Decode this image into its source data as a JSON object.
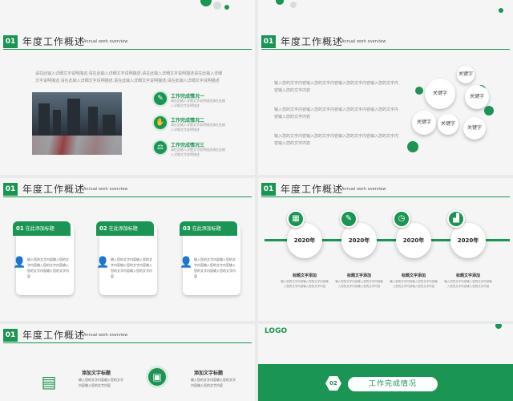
{
  "header": {
    "num": "01",
    "title": "年度工作概述",
    "subtitle": "Annual work overview"
  },
  "slide1": {
    "paragraph": "请在此输入详细文字说明描述,请在此输入详细文字说明描述,请在此输入详细文字说明描述请在此输入详细文字说明描述,请在此输入详细文字说明描述,请在此输入详细文字说明描述,请在此输入详细文字说明描述",
    "items": [
      {
        "title": "工作完成情况一",
        "desc": "请在此输入详细文字说明描述请在此输入详细文字说明描述"
      },
      {
        "title": "工作完成情况二",
        "desc": "请在此输入详细文字说明描述请在此输入详细文字说明描述"
      },
      {
        "title": "工作完成情况三",
        "desc": "请在此输入详细文字说明描述请在此输入详细文字说明描述"
      }
    ]
  },
  "slide2": {
    "paragraphs": [
      "输入您的文字内容输入您的文字内容输入您的文字内容输入您的文字内容输入您的文字内容",
      "输入您的文字内容输入您的文字内容输入您的文字内容输入您的文字内容输入您的文字内容",
      "输入您的文字内容输入您的文字内容输入您的文字内容输入您的文字内容输入您的文字内容"
    ],
    "bubbles": [
      "关键字",
      "关键字",
      "关键字",
      "关键字",
      "关键字",
      "关键字"
    ]
  },
  "slide3": {
    "cards": [
      {
        "num": "01",
        "label": "在此添加标题",
        "text": "输入您的文字内容输入您的文字内容输入您的文字内容输入您的文字内容输入您的文字内容"
      },
      {
        "num": "02",
        "label": "在此添加标题",
        "text": "输入您的文字内容输入您的文字内容输入您的文字内容输入您的文字内容输入您的文字内容"
      },
      {
        "num": "03",
        "label": "在此添加标题",
        "text": "输入您的文字内容输入您的文字内容输入您的文字内容输入您的文字内容输入您的文字内容"
      }
    ]
  },
  "slide4": {
    "milestones": [
      {
        "year": "2020年",
        "title": "标题文字添加",
        "desc": "输入您的文字内容输入您的文字内容输入您的文字内容输入您的文字内容"
      },
      {
        "year": "2020年",
        "title": "标题文字添加",
        "desc": "输入您的文字内容输入您的文字内容输入您的文字内容输入您的文字内容"
      },
      {
        "year": "2020年",
        "title": "标题文字添加",
        "desc": "输入您的文字内容输入您的文字内容输入您的文字内容输入您的文字内容"
      },
      {
        "year": "2020年",
        "title": "标题文字添加",
        "desc": "输入您的文字内容输入您的文字内容输入您的文字内容输入您的文字内容"
      }
    ]
  },
  "slide5": {
    "blocks": [
      {
        "title": "添加文字标题",
        "desc": "输入您的文字内容输入您的文字内容输入您的文字内容"
      },
      {
        "title": "添加文字标题",
        "desc": "输入您的文字内容输入您的文字内容输入您的文字内容"
      }
    ]
  },
  "slide6": {
    "logo": "LOGO",
    "num": "02",
    "title": "工作完成情况"
  },
  "colors": {
    "accent": "#1a9553"
  }
}
